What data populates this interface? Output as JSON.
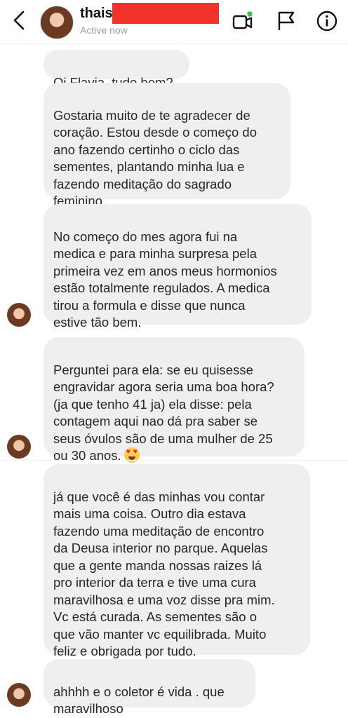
{
  "header": {
    "contact_name": "thais",
    "status": "Active now",
    "icons": [
      "back-arrow-icon",
      "video-call-icon",
      "flag-icon",
      "info-icon"
    ]
  },
  "messages": [
    {
      "text": "Oi Flavia, tudo bem?"
    },
    {
      "text": "Gostaria muito de te agradecer de\ncoração. Estou desde o começo do\nano fazendo certinho o ciclo das\nsementes, plantando minha lua e\nfazendo meditação do sagrado\nfeminino."
    },
    {
      "text": "No começo do mes agora fui na\nmedica e para minha surpresa pela\nprimeira vez em anos meus hormonios\nestão totalmente regulados. A medica\ntirou a formula e disse que nunca\nestive tão bem."
    },
    {
      "text": "Perguntei para ela: se eu quisesse\nengravidar agora seria uma boa hora?\n(ja que tenho 41 ja) ela disse: pela\ncontagem aqui nao dá pra saber se\nseus óvulos são de uma mulher de 25\nou 30 anos.",
      "emoji": "heart-eyes-emoji"
    },
    {
      "text": "já que você é das minhas vou contar\nmais uma coisa. Outro dia estava\nfazendo uma meditação de encontro\nda Deusa interior no parque. Aquelas\nque a gente manda nossas raizes lá\npro interior da terra e tive uma cura\nmaravilhosa e uma voz disse pra mim.\nVc está curada. As sementes são o\nque vão manter vc equilibrada.  Muito\nfeliz e obrigada por tudo."
    },
    {
      "text": "ahhhh e o coletor é vida . que\nmaravilhoso"
    }
  ]
}
